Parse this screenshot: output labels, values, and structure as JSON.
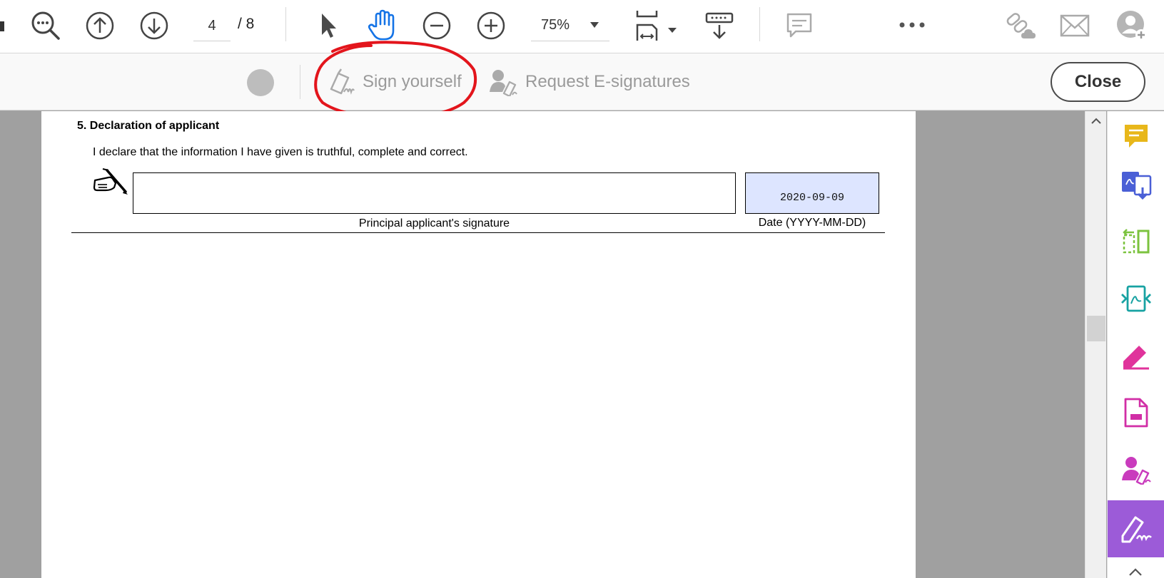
{
  "toolbar": {
    "page_current": "4",
    "page_total": "/ 8",
    "zoom": "75%"
  },
  "sign_bar": {
    "sign_yourself": "Sign yourself",
    "request_esignatures": "Request E-signatures",
    "close": "Close"
  },
  "document": {
    "section_title": "5. Declaration of applicant",
    "declaration": "I declare that the information I have given is truthful, complete and correct.",
    "signature_label": "Principal applicant's signature",
    "date_value": "2020-09-09",
    "date_label": "Date (YYYY-MM-DD)"
  },
  "colors": {
    "annotation": "#e3151c",
    "hand_tool": "#1473e6",
    "active_rail": "#9c5bd8",
    "comment_rail": "#e8b71a"
  }
}
